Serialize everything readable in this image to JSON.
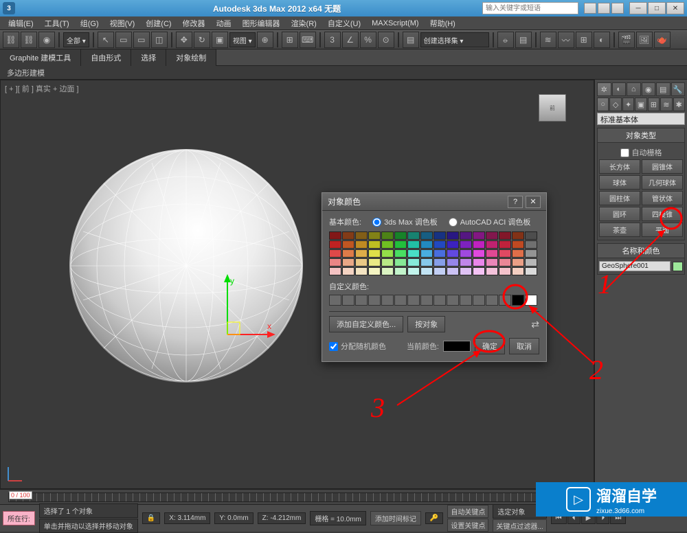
{
  "titlebar": {
    "app_title": "Autodesk 3ds Max 2012 x64  无题",
    "search_placeholder": "输入关键字或短语"
  },
  "menubar": [
    "编辑(E)",
    "工具(T)",
    "组(G)",
    "视图(V)",
    "创建(C)",
    "修改器",
    "动画",
    "图形编辑器",
    "渲染(R)",
    "自定义(U)",
    "MAXScript(M)",
    "帮助(H)"
  ],
  "toolbar": {
    "dropdown1": "全部 ▾",
    "dropdown2": "视图 ▾",
    "dropdown3": "创建选择集 ▾"
  },
  "ribbon": {
    "tabs": [
      "Graphite 建模工具",
      "自由形式",
      "选择",
      "对象绘制"
    ],
    "sub": "多边形建模"
  },
  "viewport": {
    "label": "[ + ][ 前 ] 真实 + 边面 ]",
    "cube_label": "前"
  },
  "cmdpanel": {
    "dropdown": "标准基本体",
    "rollout1_title": "对象类型",
    "autogrid": "自动栅格",
    "primitives": [
      "长方体",
      "圆锥体",
      "球体",
      "几何球体",
      "圆柱体",
      "管状体",
      "圆环",
      "四棱锥",
      "茶壶",
      "平面"
    ],
    "rollout2_title": "名称和颜色",
    "object_name": "GeoSphere001"
  },
  "dialog": {
    "title": "对象颜色",
    "basic_label": "基本颜色:",
    "radio1": "3ds Max 调色板",
    "radio2": "AutoCAD ACI 调色板",
    "custom_label": "自定义颜色:",
    "add_custom": "添加自定义颜色...",
    "by_object": "按对象",
    "assign_random": "分配随机颜色",
    "current_label": "当前颜色:",
    "ok": "确定",
    "cancel": "取消"
  },
  "annotations": {
    "n1": "1",
    "n2": "2",
    "n3": "3"
  },
  "timeline": {
    "range": "0 / 100",
    "selected": "选择了 1 个对象",
    "x": "X: 3.114mm",
    "y": "Y: 0.0mm",
    "z": "Z: -4.212mm",
    "grid": "栅格 = 10.0mm",
    "autokey": "自动关键点",
    "setkey": "设置关键点",
    "selkey": "选定对象",
    "keyfilt": "关键点过滤器...",
    "addtag": "添加时间标记",
    "hint": "单击并拖动以选择并移动对象",
    "location": "所在行:"
  },
  "watermark": {
    "main": "溜溜自学",
    "sub": "zixue.3d66.com"
  }
}
